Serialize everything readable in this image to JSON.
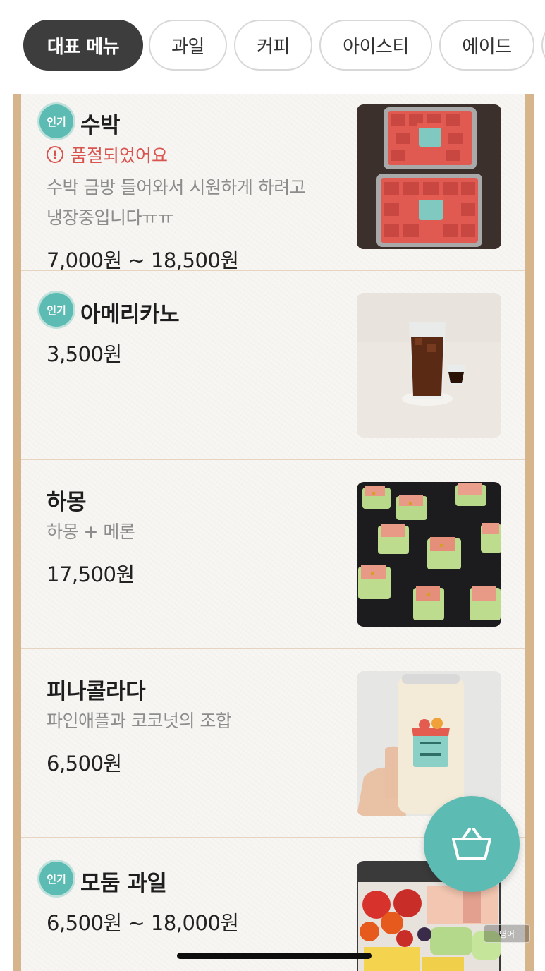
{
  "categories": [
    {
      "label": "대표 메뉴",
      "active": true
    },
    {
      "label": "과일",
      "active": false
    },
    {
      "label": "커피",
      "active": false
    },
    {
      "label": "아이스티",
      "active": false
    },
    {
      "label": "에이드",
      "active": false
    }
  ],
  "popular_label": "인기",
  "items": [
    {
      "name": "수박",
      "popular": true,
      "status": "품절되었어요",
      "description_lines": [
        "수박 금방 들어와서 시원하게 하려고",
        "냉장중입니다ㅠㅠ"
      ],
      "price": "7,000원 ~ 18,500원",
      "image": "watermelon-photo"
    },
    {
      "name": "아메리카노",
      "popular": true,
      "price": "3,500원",
      "image": "americano-photo"
    },
    {
      "name": "하몽",
      "popular": false,
      "description_lines": [
        "하몽 + 메론"
      ],
      "price": "17,500원",
      "image": "jamon-melon-photo"
    },
    {
      "name": "피나콜라다",
      "popular": false,
      "description_lines": [
        "파인애플과 코코넛의 조합"
      ],
      "price": "6,500원",
      "image": "pinacolada-photo"
    },
    {
      "name": "모둠 과일",
      "popular": true,
      "price": "6,500원 ~ 18,000원",
      "image": "mixed-fruit-photo"
    }
  ],
  "cart": {
    "icon": "basket-icon"
  },
  "corner_text": "영어",
  "colors": {
    "accent": "#5cbcb3",
    "soldout": "#d9534f",
    "active_tab": "#3d3d3d",
    "frame": "#d6b48c"
  }
}
